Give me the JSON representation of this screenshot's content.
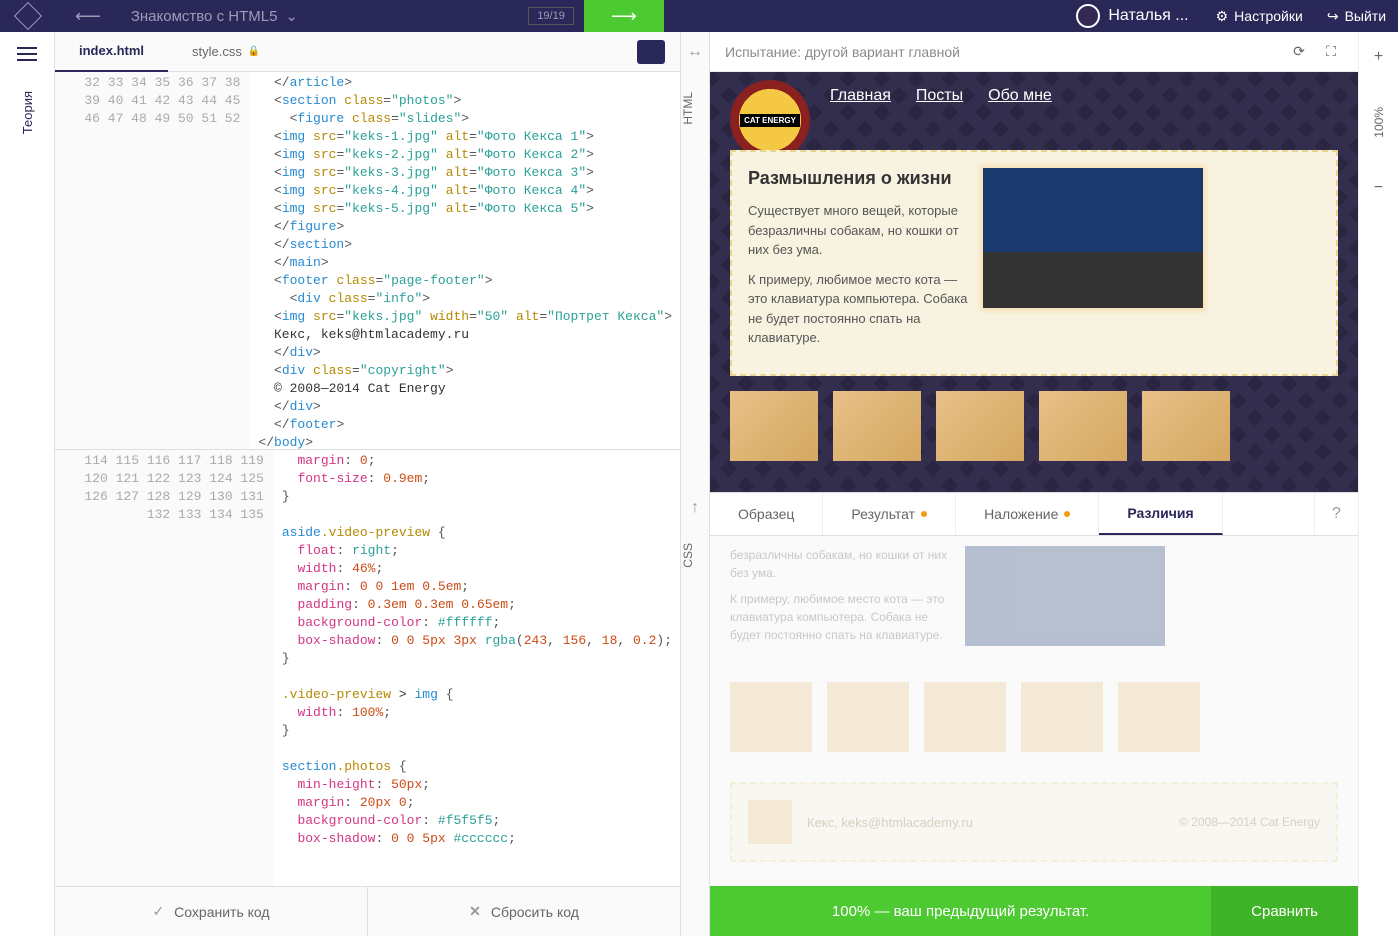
{
  "header": {
    "course_title": "Знакомство с HTML5",
    "progress": "19/19",
    "user_name": "Наталья ...",
    "settings": "Настройки",
    "logout": "Выйти"
  },
  "left_rail": {
    "theory": "Теория"
  },
  "editor": {
    "tabs": {
      "index": "index.html",
      "style": "style.css"
    },
    "footer": {
      "save": "Сохранить код",
      "reset": "Сбросить код"
    },
    "html_lines": [
      {
        "n": 32,
        "tokens": [
          [
            "pun",
            "  </"
          ],
          [
            "tag",
            "article"
          ],
          [
            "pun",
            ">"
          ]
        ]
      },
      {
        "n": 33,
        "tokens": [
          [
            "pun",
            "  <"
          ],
          [
            "tag",
            "section"
          ],
          [
            "txt",
            " "
          ],
          [
            "attr",
            "class"
          ],
          [
            "pun",
            "="
          ],
          [
            "str",
            "\"photos\""
          ],
          [
            "pun",
            ">"
          ]
        ]
      },
      {
        "n": 34,
        "tokens": [
          [
            "pun",
            "    <"
          ],
          [
            "tag",
            "figure"
          ],
          [
            "txt",
            " "
          ],
          [
            "attr",
            "class"
          ],
          [
            "pun",
            "="
          ],
          [
            "str",
            "\"slides\""
          ],
          [
            "pun",
            ">"
          ]
        ]
      },
      {
        "n": 35,
        "tokens": [
          [
            "pun",
            "  <"
          ],
          [
            "tag",
            "img"
          ],
          [
            "txt",
            " "
          ],
          [
            "attr",
            "src"
          ],
          [
            "pun",
            "="
          ],
          [
            "str",
            "\"keks-1.jpg\""
          ],
          [
            "txt",
            " "
          ],
          [
            "attr",
            "alt"
          ],
          [
            "pun",
            "="
          ],
          [
            "str",
            "\"Фото Кекса 1\""
          ],
          [
            "pun",
            ">"
          ]
        ]
      },
      {
        "n": 36,
        "tokens": [
          [
            "pun",
            "  <"
          ],
          [
            "tag",
            "img"
          ],
          [
            "txt",
            " "
          ],
          [
            "attr",
            "src"
          ],
          [
            "pun",
            "="
          ],
          [
            "str",
            "\"keks-2.jpg\""
          ],
          [
            "txt",
            " "
          ],
          [
            "attr",
            "alt"
          ],
          [
            "pun",
            "="
          ],
          [
            "str",
            "\"Фото Кекса 2\""
          ],
          [
            "pun",
            ">"
          ]
        ]
      },
      {
        "n": 37,
        "tokens": [
          [
            "pun",
            "  <"
          ],
          [
            "tag",
            "img"
          ],
          [
            "txt",
            " "
          ],
          [
            "attr",
            "src"
          ],
          [
            "pun",
            "="
          ],
          [
            "str",
            "\"keks-3.jpg\""
          ],
          [
            "txt",
            " "
          ],
          [
            "attr",
            "alt"
          ],
          [
            "pun",
            "="
          ],
          [
            "str",
            "\"Фото Кекса 3\""
          ],
          [
            "pun",
            ">"
          ]
        ]
      },
      {
        "n": 38,
        "tokens": [
          [
            "pun",
            "  <"
          ],
          [
            "tag",
            "img"
          ],
          [
            "txt",
            " "
          ],
          [
            "attr",
            "src"
          ],
          [
            "pun",
            "="
          ],
          [
            "str",
            "\"keks-4.jpg\""
          ],
          [
            "txt",
            " "
          ],
          [
            "attr",
            "alt"
          ],
          [
            "pun",
            "="
          ],
          [
            "str",
            "\"Фото Кекса 4\""
          ],
          [
            "pun",
            ">"
          ]
        ]
      },
      {
        "n": 39,
        "tokens": [
          [
            "pun",
            "  <"
          ],
          [
            "tag",
            "img"
          ],
          [
            "txt",
            " "
          ],
          [
            "attr",
            "src"
          ],
          [
            "pun",
            "="
          ],
          [
            "str",
            "\"keks-5.jpg\""
          ],
          [
            "txt",
            " "
          ],
          [
            "attr",
            "alt"
          ],
          [
            "pun",
            "="
          ],
          [
            "str",
            "\"Фото Кекса 5\""
          ],
          [
            "pun",
            ">"
          ]
        ]
      },
      {
        "n": 40,
        "tokens": [
          [
            "pun",
            "  </"
          ],
          [
            "tag",
            "figure"
          ],
          [
            "pun",
            ">"
          ]
        ]
      },
      {
        "n": 41,
        "tokens": [
          [
            "pun",
            "  </"
          ],
          [
            "tag",
            "section"
          ],
          [
            "pun",
            ">"
          ]
        ]
      },
      {
        "n": 42,
        "tokens": [
          [
            "pun",
            "  </"
          ],
          [
            "tag",
            "main"
          ],
          [
            "pun",
            ">"
          ]
        ]
      },
      {
        "n": 43,
        "tokens": [
          [
            "pun",
            "  <"
          ],
          [
            "tag",
            "footer"
          ],
          [
            "txt",
            " "
          ],
          [
            "attr",
            "class"
          ],
          [
            "pun",
            "="
          ],
          [
            "str",
            "\"page-footer\""
          ],
          [
            "pun",
            ">"
          ]
        ]
      },
      {
        "n": 44,
        "tokens": [
          [
            "pun",
            "    <"
          ],
          [
            "tag",
            "div"
          ],
          [
            "txt",
            " "
          ],
          [
            "attr",
            "class"
          ],
          [
            "pun",
            "="
          ],
          [
            "str",
            "\"info\""
          ],
          [
            "pun",
            ">"
          ]
        ]
      },
      {
        "n": 45,
        "tokens": [
          [
            "pun",
            "  <"
          ],
          [
            "tag",
            "img"
          ],
          [
            "txt",
            " "
          ],
          [
            "attr",
            "src"
          ],
          [
            "pun",
            "="
          ],
          [
            "str",
            "\"keks.jpg\""
          ],
          [
            "txt",
            " "
          ],
          [
            "attr",
            "width"
          ],
          [
            "pun",
            "="
          ],
          [
            "str",
            "\"50\""
          ],
          [
            "txt",
            " "
          ],
          [
            "attr",
            "alt"
          ],
          [
            "pun",
            "="
          ],
          [
            "str",
            "\"Портрет Кекса\""
          ],
          [
            "pun",
            ">"
          ]
        ]
      },
      {
        "n": 46,
        "tokens": [
          [
            "txt",
            "  Кекс, keks@htmlacademy.ru"
          ]
        ]
      },
      {
        "n": 47,
        "tokens": [
          [
            "pun",
            "  </"
          ],
          [
            "tag",
            "div"
          ],
          [
            "pun",
            ">"
          ]
        ]
      },
      {
        "n": 48,
        "tokens": [
          [
            "pun",
            "  <"
          ],
          [
            "tag",
            "div"
          ],
          [
            "txt",
            " "
          ],
          [
            "attr",
            "class"
          ],
          [
            "pun",
            "="
          ],
          [
            "str",
            "\"copyright\""
          ],
          [
            "pun",
            ">"
          ]
        ]
      },
      {
        "n": 49,
        "tokens": [
          [
            "txt",
            "  © 2008—2014 Cat Energy"
          ]
        ]
      },
      {
        "n": 50,
        "tokens": [
          [
            "pun",
            "  </"
          ],
          [
            "tag",
            "div"
          ],
          [
            "pun",
            ">"
          ]
        ]
      },
      {
        "n": 51,
        "tokens": [
          [
            "pun",
            "  </"
          ],
          [
            "tag",
            "footer"
          ],
          [
            "pun",
            ">"
          ]
        ]
      },
      {
        "n": 52,
        "tokens": [
          [
            "pun",
            "</"
          ],
          [
            "tag",
            "body"
          ],
          [
            "pun",
            ">"
          ]
        ]
      }
    ],
    "css_lines": [
      {
        "n": 114,
        "tokens": [
          [
            "txt",
            "  "
          ],
          [
            "prop",
            "margin"
          ],
          [
            "pun",
            ": "
          ],
          [
            "num",
            "0"
          ],
          [
            "pun",
            ";"
          ]
        ]
      },
      {
        "n": 115,
        "tokens": [
          [
            "txt",
            "  "
          ],
          [
            "prop",
            "font-size"
          ],
          [
            "pun",
            ": "
          ],
          [
            "num",
            "0.9em"
          ],
          [
            "pun",
            ";"
          ]
        ]
      },
      {
        "n": 116,
        "tokens": [
          [
            "pun",
            "}"
          ]
        ]
      },
      {
        "n": 117,
        "tokens": [
          [
            "txt",
            ""
          ]
        ]
      },
      {
        "n": 118,
        "tokens": [
          [
            "sel",
            "aside"
          ],
          [
            "cls",
            ".video-preview"
          ],
          [
            "txt",
            " "
          ],
          [
            "pun",
            "{"
          ]
        ]
      },
      {
        "n": 119,
        "tokens": [
          [
            "txt",
            "  "
          ],
          [
            "prop",
            "float"
          ],
          [
            "pun",
            ": "
          ],
          [
            "val",
            "right"
          ],
          [
            "pun",
            ";"
          ]
        ]
      },
      {
        "n": 120,
        "tokens": [
          [
            "txt",
            "  "
          ],
          [
            "prop",
            "width"
          ],
          [
            "pun",
            ": "
          ],
          [
            "num",
            "46%"
          ],
          [
            "pun",
            ";"
          ]
        ]
      },
      {
        "n": 121,
        "tokens": [
          [
            "txt",
            "  "
          ],
          [
            "prop",
            "margin"
          ],
          [
            "pun",
            ": "
          ],
          [
            "num",
            "0 0 1em 0.5em"
          ],
          [
            "pun",
            ";"
          ]
        ]
      },
      {
        "n": 122,
        "tokens": [
          [
            "txt",
            "  "
          ],
          [
            "prop",
            "padding"
          ],
          [
            "pun",
            ": "
          ],
          [
            "num",
            "0.3em 0.3em 0.65em"
          ],
          [
            "pun",
            ";"
          ]
        ]
      },
      {
        "n": 123,
        "tokens": [
          [
            "txt",
            "  "
          ],
          [
            "prop",
            "background-color"
          ],
          [
            "pun",
            ": "
          ],
          [
            "val",
            "#ffffff"
          ],
          [
            "pun",
            ";"
          ]
        ]
      },
      {
        "n": 124,
        "tokens": [
          [
            "txt",
            "  "
          ],
          [
            "prop",
            "box-shadow"
          ],
          [
            "pun",
            ": "
          ],
          [
            "num",
            "0 0 5px 3px "
          ],
          [
            "val",
            "rgba"
          ],
          [
            "pun",
            "("
          ],
          [
            "num",
            "243"
          ],
          [
            "pun",
            ", "
          ],
          [
            "num",
            "156"
          ],
          [
            "pun",
            ", "
          ],
          [
            "num",
            "18"
          ],
          [
            "pun",
            ", "
          ],
          [
            "num",
            "0.2"
          ],
          [
            "pun",
            ");"
          ]
        ]
      },
      {
        "n": 125,
        "tokens": [
          [
            "pun",
            "}"
          ]
        ]
      },
      {
        "n": 126,
        "tokens": [
          [
            "txt",
            ""
          ]
        ]
      },
      {
        "n": 127,
        "tokens": [
          [
            "cls",
            ".video-preview"
          ],
          [
            "txt",
            " > "
          ],
          [
            "sel",
            "img"
          ],
          [
            "txt",
            " "
          ],
          [
            "pun",
            "{"
          ]
        ]
      },
      {
        "n": 128,
        "tokens": [
          [
            "txt",
            "  "
          ],
          [
            "prop",
            "width"
          ],
          [
            "pun",
            ": "
          ],
          [
            "num",
            "100%"
          ],
          [
            "pun",
            ";"
          ]
        ]
      },
      {
        "n": 129,
        "tokens": [
          [
            "pun",
            "}"
          ]
        ]
      },
      {
        "n": 130,
        "tokens": [
          [
            "txt",
            ""
          ]
        ]
      },
      {
        "n": 131,
        "tokens": [
          [
            "sel",
            "section"
          ],
          [
            "cls",
            ".photos"
          ],
          [
            "txt",
            " "
          ],
          [
            "pun",
            "{"
          ]
        ]
      },
      {
        "n": 132,
        "tokens": [
          [
            "txt",
            "  "
          ],
          [
            "prop",
            "min-height"
          ],
          [
            "pun",
            ": "
          ],
          [
            "num",
            "50px"
          ],
          [
            "pun",
            ";"
          ]
        ]
      },
      {
        "n": 133,
        "tokens": [
          [
            "txt",
            "  "
          ],
          [
            "prop",
            "margin"
          ],
          [
            "pun",
            ": "
          ],
          [
            "num",
            "20px 0"
          ],
          [
            "pun",
            ";"
          ]
        ]
      },
      {
        "n": 134,
        "tokens": [
          [
            "txt",
            "  "
          ],
          [
            "prop",
            "background-color"
          ],
          [
            "pun",
            ": "
          ],
          [
            "val",
            "#f5f5f5"
          ],
          [
            "pun",
            ";"
          ]
        ]
      },
      {
        "n": 135,
        "tokens": [
          [
            "txt",
            "  "
          ],
          [
            "prop",
            "box-shadow"
          ],
          [
            "pun",
            ": "
          ],
          [
            "num",
            "0 0 5px "
          ],
          [
            "val",
            "#cccccc"
          ],
          [
            "pun",
            ";"
          ]
        ]
      }
    ]
  },
  "mid_rail": {
    "html": "HTML",
    "css": "CSS"
  },
  "preview": {
    "header_text": "Испытание: другой вариант главной",
    "site": {
      "logo": "CAT ENERGY",
      "nav": [
        "Главная",
        "Посты",
        "Обо мне"
      ],
      "article_title": "Размышления о жизни",
      "article_p1": "Существует много вещей, которые безразличны собакам, но кошки от них без ума.",
      "article_p2": "К примеру, любимое место кота — это клавиатура компьютера. Собака не будет постоянно спать на клавиатуре."
    },
    "compare_tabs": {
      "sample": "Образец",
      "result": "Результат",
      "overlay": "Наложение",
      "diff": "Различия",
      "help": "?"
    },
    "diff": {
      "p1": "безразличны собакам, но кошки от них без ума.",
      "p2": "К примеру, любимое место кота — это клавиатура компьютера. Собака не будет постоянно спать на клавиатуре.",
      "footer_text": "Кекс, keks@htmlacademy.ru",
      "copyright": "© 2008—2014 Cat Energy"
    },
    "compare_footer": {
      "text": "100% — ваш предыдущий результат.",
      "button": "Сравнить"
    }
  },
  "right_rail": {
    "zoom": "100%"
  }
}
